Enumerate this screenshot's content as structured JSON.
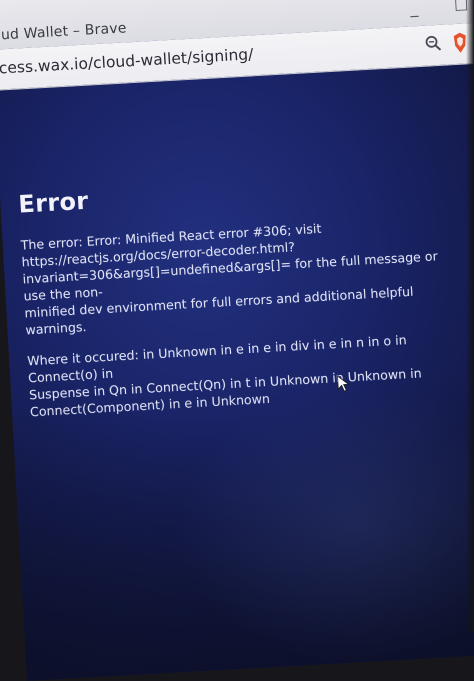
{
  "browser": {
    "window_title": "ud Wallet – Brave",
    "url": "cess.wax.io/cloud-wallet/signing/",
    "minimize_label": "_",
    "maximize_label": "☐"
  },
  "page": {
    "heading": "Error",
    "error_line1": "The error: Error: Minified React error #306; visit",
    "error_line2": "https://reactjs.org/docs/error-decoder.html?",
    "error_line3": "invariant=306&args[]=undefined&args[]= for the full message or use the non-",
    "error_line4": "minified dev environment for full errors and additional helpful warnings.",
    "where_line1": "Where it occured: in Unknown in e in e in div in e in n in o in Connect(o) in",
    "where_line2": "Suspense in Qn in Connect(Qn) in t in Unknown in Unknown in",
    "where_line3": "Connect(Component) in e in Unknown"
  },
  "icons": {
    "zoom": "magnifier-icon",
    "extension": "extension-icon",
    "cursor": "mouse-pointer-icon"
  },
  "colors": {
    "screen_background": "#1a2468",
    "text": "#dfe2f4",
    "chrome": "#e9e9ee"
  }
}
